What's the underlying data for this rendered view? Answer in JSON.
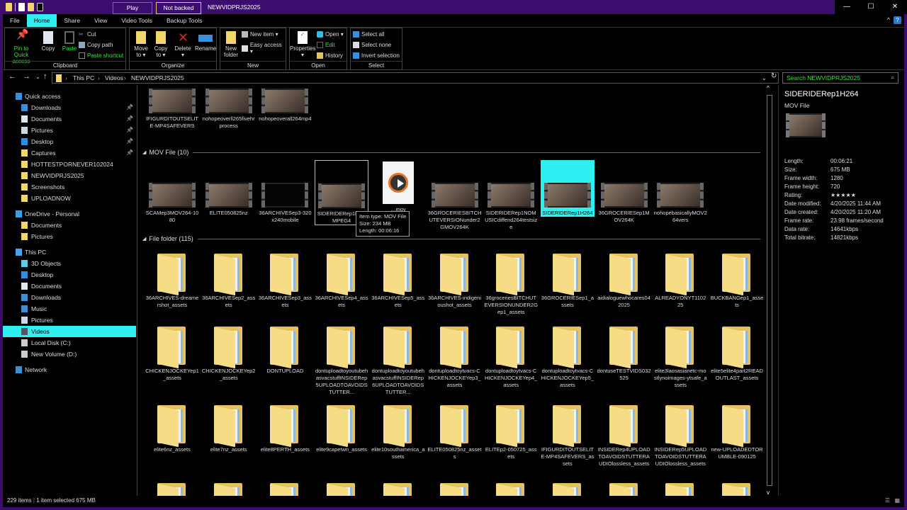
{
  "titlebar": {
    "play": "Play",
    "not_backed_up": "Not backed up",
    "title": "NEWVIDPRJS2025",
    "minimize": "—",
    "maximize": "☐",
    "close": "✕"
  },
  "tabs": [
    "File",
    "Home",
    "Share",
    "View",
    "Video Tools",
    "Backup Tools"
  ],
  "ribbon": {
    "clipboard": {
      "label": "Clipboard",
      "pin": "Pin to Quick access",
      "copy": "Copy",
      "paste": "Paste",
      "cut": "Cut",
      "copy_path": "Copy path",
      "paste_shortcut": "Paste shortcut"
    },
    "organize": {
      "label": "Organize",
      "move_to": "Move to ▾",
      "copy_to": "Copy to ▾",
      "delete": "Delete ▾",
      "rename": "Rename"
    },
    "new": {
      "label": "New",
      "new_folder": "New folder",
      "new_item": "New item ▾",
      "easy_access": "Easy access ▾"
    },
    "open": {
      "label": "Open",
      "properties": "Properties ▾",
      "open": "Open ▾",
      "edit": "Edit",
      "history": "History"
    },
    "select": {
      "label": "Select",
      "select_all": "Select all",
      "select_none": "Select none",
      "invert": "Invert selection"
    }
  },
  "address": {
    "crumbs": [
      "This PC",
      "Videos",
      "NEWVIDPRJS2025"
    ],
    "search_placeholder": "Search NEWVIDPRJS2025"
  },
  "nav": [
    {
      "label": "Quick access",
      "icon": "star",
      "indent": 0,
      "pin": false
    },
    {
      "label": "Downloads",
      "icon": "download",
      "indent": 1,
      "pin": true
    },
    {
      "label": "Documents",
      "icon": "document",
      "indent": 1,
      "pin": true
    },
    {
      "label": "Pictures",
      "icon": "pictures",
      "indent": 1,
      "pin": true
    },
    {
      "label": "Desktop",
      "icon": "desktop",
      "indent": 1,
      "pin": true
    },
    {
      "label": "Captures",
      "icon": "folder",
      "indent": 1,
      "pin": true
    },
    {
      "label": "HOTTESTPORNEVER102024",
      "icon": "folder",
      "indent": 1,
      "pin": false
    },
    {
      "label": "NEWVIDPRJS2025",
      "icon": "folder",
      "indent": 1,
      "pin": false
    },
    {
      "label": "Screenshots",
      "icon": "folder",
      "indent": 1,
      "pin": false
    },
    {
      "label": "UPLOADNOW",
      "icon": "folder",
      "indent": 1,
      "pin": false
    },
    {
      "label": "OneDrive - Personal",
      "icon": "cloud",
      "indent": 0,
      "pin": false
    },
    {
      "label": "Documents",
      "icon": "folder",
      "indent": 1,
      "pin": false
    },
    {
      "label": "Pictures",
      "icon": "folder",
      "indent": 1,
      "pin": false
    },
    {
      "label": "This PC",
      "icon": "computer",
      "indent": 0,
      "pin": false
    },
    {
      "label": "3D Objects",
      "icon": "cube",
      "indent": 1,
      "pin": false
    },
    {
      "label": "Desktop",
      "icon": "desktop",
      "indent": 1,
      "pin": false
    },
    {
      "label": "Documents",
      "icon": "document",
      "indent": 1,
      "pin": false
    },
    {
      "label": "Downloads",
      "icon": "download",
      "indent": 1,
      "pin": false
    },
    {
      "label": "Music",
      "icon": "music",
      "indent": 1,
      "pin": false
    },
    {
      "label": "Pictures",
      "icon": "pictures",
      "indent": 1,
      "pin": false
    },
    {
      "label": "Videos",
      "icon": "videos",
      "indent": 1,
      "pin": false,
      "selected": true
    },
    {
      "label": "Local Disk (C:)",
      "icon": "drive",
      "indent": 1,
      "pin": false
    },
    {
      "label": "New Volume (D:)",
      "icon": "drive",
      "indent": 1,
      "pin": false
    },
    {
      "label": "Network",
      "icon": "network",
      "indent": 0,
      "pin": false
    }
  ],
  "pin_glyph": "📌",
  "top_items": [
    "IFIGURDITOUTSELITE-MP4SAFEVERS",
    "nohopeoverll265fivehrprocess",
    "nohopeoverall264mp4"
  ],
  "mov_group": {
    "label": "MOV File (10)",
    "items": [
      {
        "name": "SCAMep3MOV264-1080"
      },
      {
        "name": "ELITE050825nz"
      },
      {
        "name": "36ARCHIVESep3-320x240mobile",
        "dark": true
      },
      {
        "name": "SIDERIDERep1HEVMPEG4",
        "hover": true
      },
      {
        "name": "…mov",
        "generic": true
      },
      {
        "name": "36GROCERIESBITCHUTEVERSIONunder2GMOV264K"
      },
      {
        "name": "SIDERIDERep1NOMUSICdiffend264testsize"
      },
      {
        "name": "SIDERIDERep1H264",
        "selected": true
      },
      {
        "name": "36GROCERIESep1MOV264K"
      },
      {
        "name": "nohopebasicallyMOV264vers"
      }
    ]
  },
  "tooltip": {
    "type": "Item type: MOV File",
    "size": "Size: 234 MB",
    "length": "Length: 00:06:16"
  },
  "folder_group": {
    "label": "File folder (115)",
    "rows": [
      [
        "36ARCHIVES-dreamershot_assets",
        "36ARCHIVESep2_assets",
        "36ARCHIVESep3_assets",
        "36ARCHIVESep4_assets",
        "36ARCHIVESep5_assets",
        "36ARCHIVES-indigenioushot_assets",
        "36groceriesBITCHUTEVERSIONUNDER2Gep1_assets",
        "36GROCERIESep1_assets",
        "aidialoguewhocares042025",
        "ALREADYONYT110225",
        "BUCKBANGep1_assets"
      ],
      [
        "CHICKENJOCKEYep1_assets",
        "CHICKENJOCKEYep2_assets",
        "DONTUPLOAD",
        "dontuploadtoyoutubehasvacstuffINSIDERep5UPLOADTOAVOIDSTUTTER...",
        "dontuploadtoyoutubehasvacstuffINSIDERep6UPLOADTOAVOIDSTUTTER...",
        "dontuploadtoytvacs-CHICKENJOCKEYep3_assets",
        "dontuploadtoytvacs-CHICKENJOCKEYep4_assets",
        "dontuploadtoytvacs-CHICKENJOCKEYep5_assets",
        "dontuseTESTVIDS032525",
        "elite3laosasianetc-mostlynoimages-ytsafe_assets",
        "elite5elite4part2READOUTLAST_assets"
      ],
      [
        "elite6nz_assets",
        "elite7nz_assets",
        "elite8PERTH_assets",
        "elite9capetwn_assets",
        "elite10southamerica_assets",
        "ELITE050825nz_assets",
        "ELITEp2-050725_assets",
        "IFIGURDITOUTSELITE-MP4SAFEVERS_assets",
        "INSIDERep4UPLOADTOAVOIDSTUTTERAUDIOlossless_assets",
        "INSIDERep5UPLOADTOAVOIDSTUTTERAUDIOlossless_assets",
        "new-UPLOADEDTORUMBLE-090125"
      ]
    ]
  },
  "details": {
    "title": "SIDERIDERep1H264",
    "type": "MOV File",
    "props": [
      {
        "k": "Length:",
        "v": "00:06:21"
      },
      {
        "k": "Size:",
        "v": "675 MB"
      },
      {
        "k": "Frame width:",
        "v": "1280"
      },
      {
        "k": "Frame height:",
        "v": "720"
      },
      {
        "k": "Rating:",
        "v": "★★★★★"
      },
      {
        "k": "Date modified:",
        "v": "4/20/2025 11:44 AM"
      },
      {
        "k": "Date created:",
        "v": "4/20/2025 11:20 AM"
      },
      {
        "k": "Frame rate:",
        "v": "23.98 frames/second"
      },
      {
        "k": "Data rate:",
        "v": "14641kbps"
      },
      {
        "k": "Total bitrate:",
        "v": "14821kbps"
      }
    ]
  },
  "status": {
    "items": "229 items",
    "selected": "1 item selected  675 MB"
  },
  "colors": {
    "accent": "#2ef0f0",
    "title_bg": "#3a0d6e",
    "green_text": "#3ee03e"
  }
}
